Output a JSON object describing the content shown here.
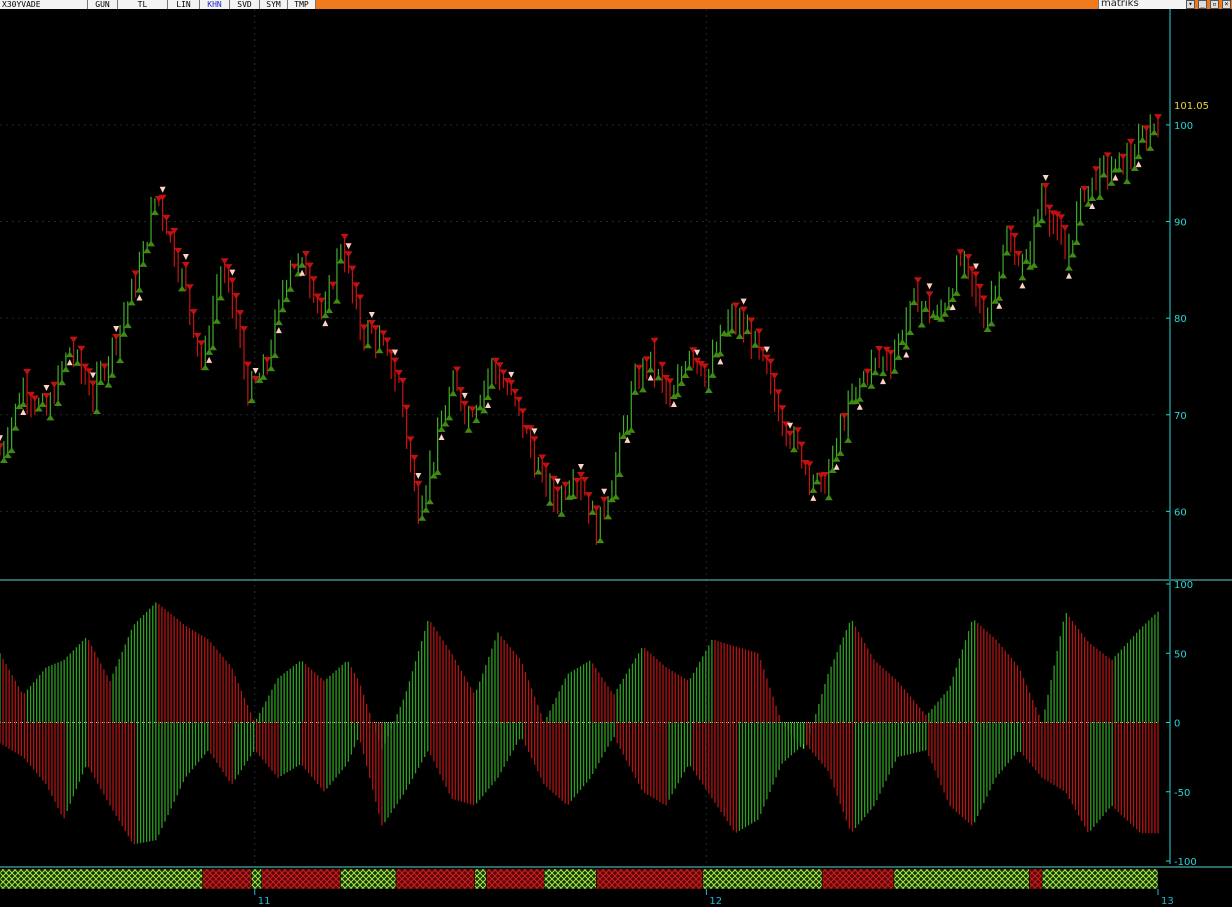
{
  "toolbar": {
    "symbol": "X30YVADE",
    "items": [
      "GUN",
      "TL",
      "LIN",
      "KHN",
      "SVD",
      "SYM",
      "TMP"
    ],
    "active": "KHN",
    "brand": "matriks"
  },
  "colors": {
    "background": "#000000",
    "toolbar": "#f07a1c",
    "axis": "#27d6d6",
    "bull_bar": "#3fae2a",
    "bear_bar": "#c81414",
    "bull_marker": "#3f8a12",
    "bear_marker": "#c01010",
    "signal_marker": "#ffd2c4",
    "hist_bull": "#2f9e22",
    "hist_bear": "#b41414",
    "hist_bright": "#4cff3a",
    "last_price": "#e8d43a"
  },
  "chart_data": [
    {
      "type": "line",
      "panel": "price",
      "last_price_label": "101.05",
      "last_price": 101.05,
      "y_ticks": [
        60,
        70,
        80,
        90,
        100
      ],
      "ylim": [
        53,
        112
      ],
      "x_ticks": [
        {
          "label": "11",
          "x": 0.22
        },
        {
          "label": "12",
          "x": 0.61
        },
        {
          "label": "13",
          "x": 1.0
        }
      ],
      "xlim": [
        0,
        1
      ],
      "grid": true,
      "series": [
        {
          "x": [
            0,
            0.02,
            0.04,
            0.06,
            0.08,
            0.1,
            0.12,
            0.135,
            0.15,
            0.16,
            0.175,
            0.19,
            0.2,
            0.215,
            0.23,
            0.25,
            0.265,
            0.28,
            0.295,
            0.31,
            0.325,
            0.345,
            0.36,
            0.375,
            0.39,
            0.405,
            0.425,
            0.445,
            0.465,
            0.48,
            0.495,
            0.505,
            0.515,
            0.53,
            0.545,
            0.56,
            0.58,
            0.595,
            0.61,
            0.63,
            0.65,
            0.67,
            0.69,
            0.71,
            0.73,
            0.75,
            0.77,
            0.79,
            0.81,
            0.83,
            0.85,
            0.87,
            0.885,
            0.9,
            0.92,
            0.935,
            0.95,
            0.97,
            0.985,
            1.0
          ],
          "y": [
            66,
            73,
            70,
            77,
            72,
            78,
            85,
            93,
            87,
            83,
            75,
            85,
            82,
            72,
            75,
            86,
            85,
            80,
            88,
            79,
            78,
            73,
            60,
            66,
            73,
            70,
            75,
            71,
            64,
            61,
            64,
            62,
            58,
            64,
            72,
            76,
            71,
            77,
            74,
            80,
            78,
            71,
            66,
            62,
            70,
            75,
            76,
            82,
            80,
            86,
            80,
            88,
            85,
            93,
            86,
            93,
            95,
            96,
            98,
            101
          ]
        }
      ]
    },
    {
      "type": "bar",
      "panel": "oscillator",
      "y_ticks": [
        100,
        50,
        0,
        -50,
        -100
      ],
      "ylim": [
        -100,
        100
      ],
      "xlim": [
        0,
        1
      ],
      "series": [
        {
          "name": "",
          "x": [
            0,
            0.02,
            0.04,
            0.055,
            0.075,
            0.095,
            0.115,
            0.135,
            0.16,
            0.18,
            0.2,
            0.22,
            0.24,
            0.26,
            0.28,
            0.3,
            0.31,
            0.33,
            0.35,
            0.37,
            0.39,
            0.41,
            0.43,
            0.45,
            0.47,
            0.49,
            0.51,
            0.53,
            0.555,
            0.575,
            0.595,
            0.615,
            0.635,
            0.655,
            0.675,
            0.695,
            0.715,
            0.735,
            0.755,
            0.775,
            0.8,
            0.82,
            0.84,
            0.86,
            0.88,
            0.9,
            0.92,
            0.94,
            0.96,
            0.985,
            1.0
          ],
          "y": [
            50,
            20,
            40,
            45,
            62,
            30,
            70,
            87,
            70,
            60,
            40,
            0,
            32,
            45,
            30,
            45,
            30,
            -20,
            20,
            75,
            50,
            20,
            65,
            45,
            0,
            35,
            45,
            20,
            55,
            40,
            30,
            60,
            55,
            50,
            0,
            -20,
            35,
            75,
            45,
            30,
            5,
            25,
            75,
            60,
            40,
            0,
            80,
            58,
            45,
            68,
            80
          ]
        },
        {
          "name": "",
          "x": [
            0,
            0.02,
            0.04,
            0.055,
            0.075,
            0.095,
            0.115,
            0.135,
            0.16,
            0.18,
            0.2,
            0.22,
            0.24,
            0.26,
            0.28,
            0.3,
            0.31,
            0.33,
            0.35,
            0.37,
            0.39,
            0.41,
            0.43,
            0.45,
            0.47,
            0.49,
            0.51,
            0.53,
            0.555,
            0.575,
            0.595,
            0.615,
            0.635,
            0.655,
            0.675,
            0.695,
            0.715,
            0.735,
            0.755,
            0.775,
            0.8,
            0.82,
            0.84,
            0.86,
            0.88,
            0.9,
            0.92,
            0.94,
            0.96,
            0.985,
            1.0
          ],
          "y": [
            -15,
            -25,
            -45,
            -70,
            -30,
            -60,
            -88,
            -85,
            -40,
            -20,
            -45,
            -20,
            -40,
            -30,
            -50,
            -30,
            -10,
            -75,
            -50,
            -20,
            -55,
            -60,
            -40,
            -10,
            -45,
            -60,
            -40,
            -10,
            -50,
            -60,
            -30,
            -55,
            -80,
            -70,
            -30,
            -15,
            -35,
            -80,
            -60,
            -25,
            -20,
            -60,
            -75,
            -40,
            -20,
            -40,
            -50,
            -80,
            -60,
            -80,
            -80
          ]
        }
      ]
    }
  ],
  "regime_bar": {
    "segments": [
      {
        "start": 0.0,
        "end": 0.175,
        "state": "bull"
      },
      {
        "start": 0.175,
        "end": 0.217,
        "state": "bear"
      },
      {
        "start": 0.217,
        "end": 0.226,
        "state": "bull"
      },
      {
        "start": 0.226,
        "end": 0.294,
        "state": "bear"
      },
      {
        "start": 0.294,
        "end": 0.342,
        "state": "bull"
      },
      {
        "start": 0.342,
        "end": 0.41,
        "state": "bear"
      },
      {
        "start": 0.41,
        "end": 0.42,
        "state": "bull"
      },
      {
        "start": 0.42,
        "end": 0.47,
        "state": "bear"
      },
      {
        "start": 0.47,
        "end": 0.515,
        "state": "bull"
      },
      {
        "start": 0.515,
        "end": 0.607,
        "state": "bear"
      },
      {
        "start": 0.607,
        "end": 0.71,
        "state": "bull"
      },
      {
        "start": 0.71,
        "end": 0.772,
        "state": "bear"
      },
      {
        "start": 0.772,
        "end": 0.889,
        "state": "bull"
      },
      {
        "start": 0.889,
        "end": 0.9,
        "state": "bear"
      },
      {
        "start": 0.9,
        "end": 1.0,
        "state": "bull"
      }
    ]
  }
}
